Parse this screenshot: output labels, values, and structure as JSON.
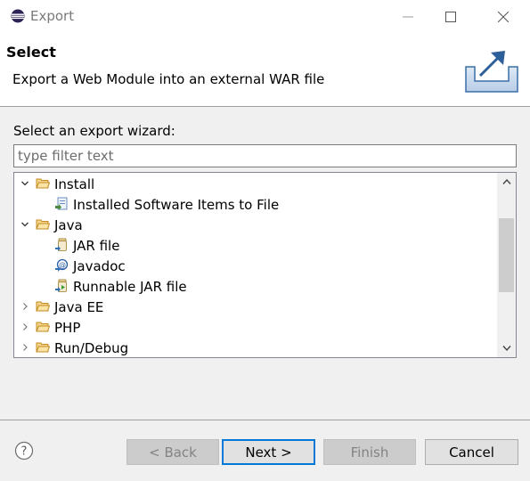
{
  "window": {
    "title": "Export",
    "icon": "eclipse-icon"
  },
  "header": {
    "title": "Select",
    "description": "Export a Web Module into an external WAR file",
    "graphic": "export-wizard-graphic"
  },
  "wizard": {
    "label": "Select an export wizard:",
    "filter_placeholder": "type filter text",
    "filter_value": "",
    "tree": [
      {
        "label": "Install",
        "expanded": true,
        "level": 0,
        "icon": "folder-icon"
      },
      {
        "label": "Installed Software Items to File",
        "level": 1,
        "icon": "software-export-icon"
      },
      {
        "label": "Java",
        "expanded": true,
        "level": 0,
        "icon": "folder-icon"
      },
      {
        "label": "JAR file",
        "level": 1,
        "icon": "jar-file-icon"
      },
      {
        "label": "Javadoc",
        "level": 1,
        "icon": "javadoc-icon"
      },
      {
        "label": "Runnable JAR file",
        "level": 1,
        "icon": "runnable-jar-icon"
      },
      {
        "label": "Java EE",
        "expanded": false,
        "level": 0,
        "icon": "folder-icon"
      },
      {
        "label": "PHP",
        "expanded": false,
        "level": 0,
        "icon": "folder-icon"
      },
      {
        "label": "Run/Debug",
        "expanded": false,
        "level": 0,
        "icon": "folder-icon"
      }
    ]
  },
  "buttons": {
    "back": "< Back",
    "next": "Next >",
    "finish": "Finish",
    "cancel": "Cancel"
  },
  "colors": {
    "accent": "#0078d7",
    "folder": "#e8b84a"
  }
}
